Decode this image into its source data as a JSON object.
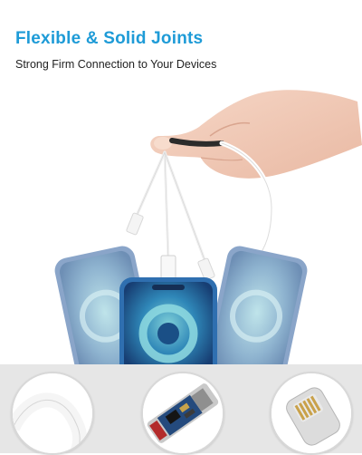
{
  "headline": "Flexible & Solid Joints",
  "subline": "Strong Firm Connection to Your Devices",
  "colors": {
    "headline": "#1e9bd7",
    "phone_frame": "#2f6fb0",
    "screen_blue": "#1f5d9a",
    "teal": "#5fb7c4"
  },
  "icons": [
    "hand-illustration",
    "cable-illustration",
    "phone-illustration",
    "cable-bend-detail",
    "cable-pcb-detail",
    "lightning-connector-detail"
  ]
}
